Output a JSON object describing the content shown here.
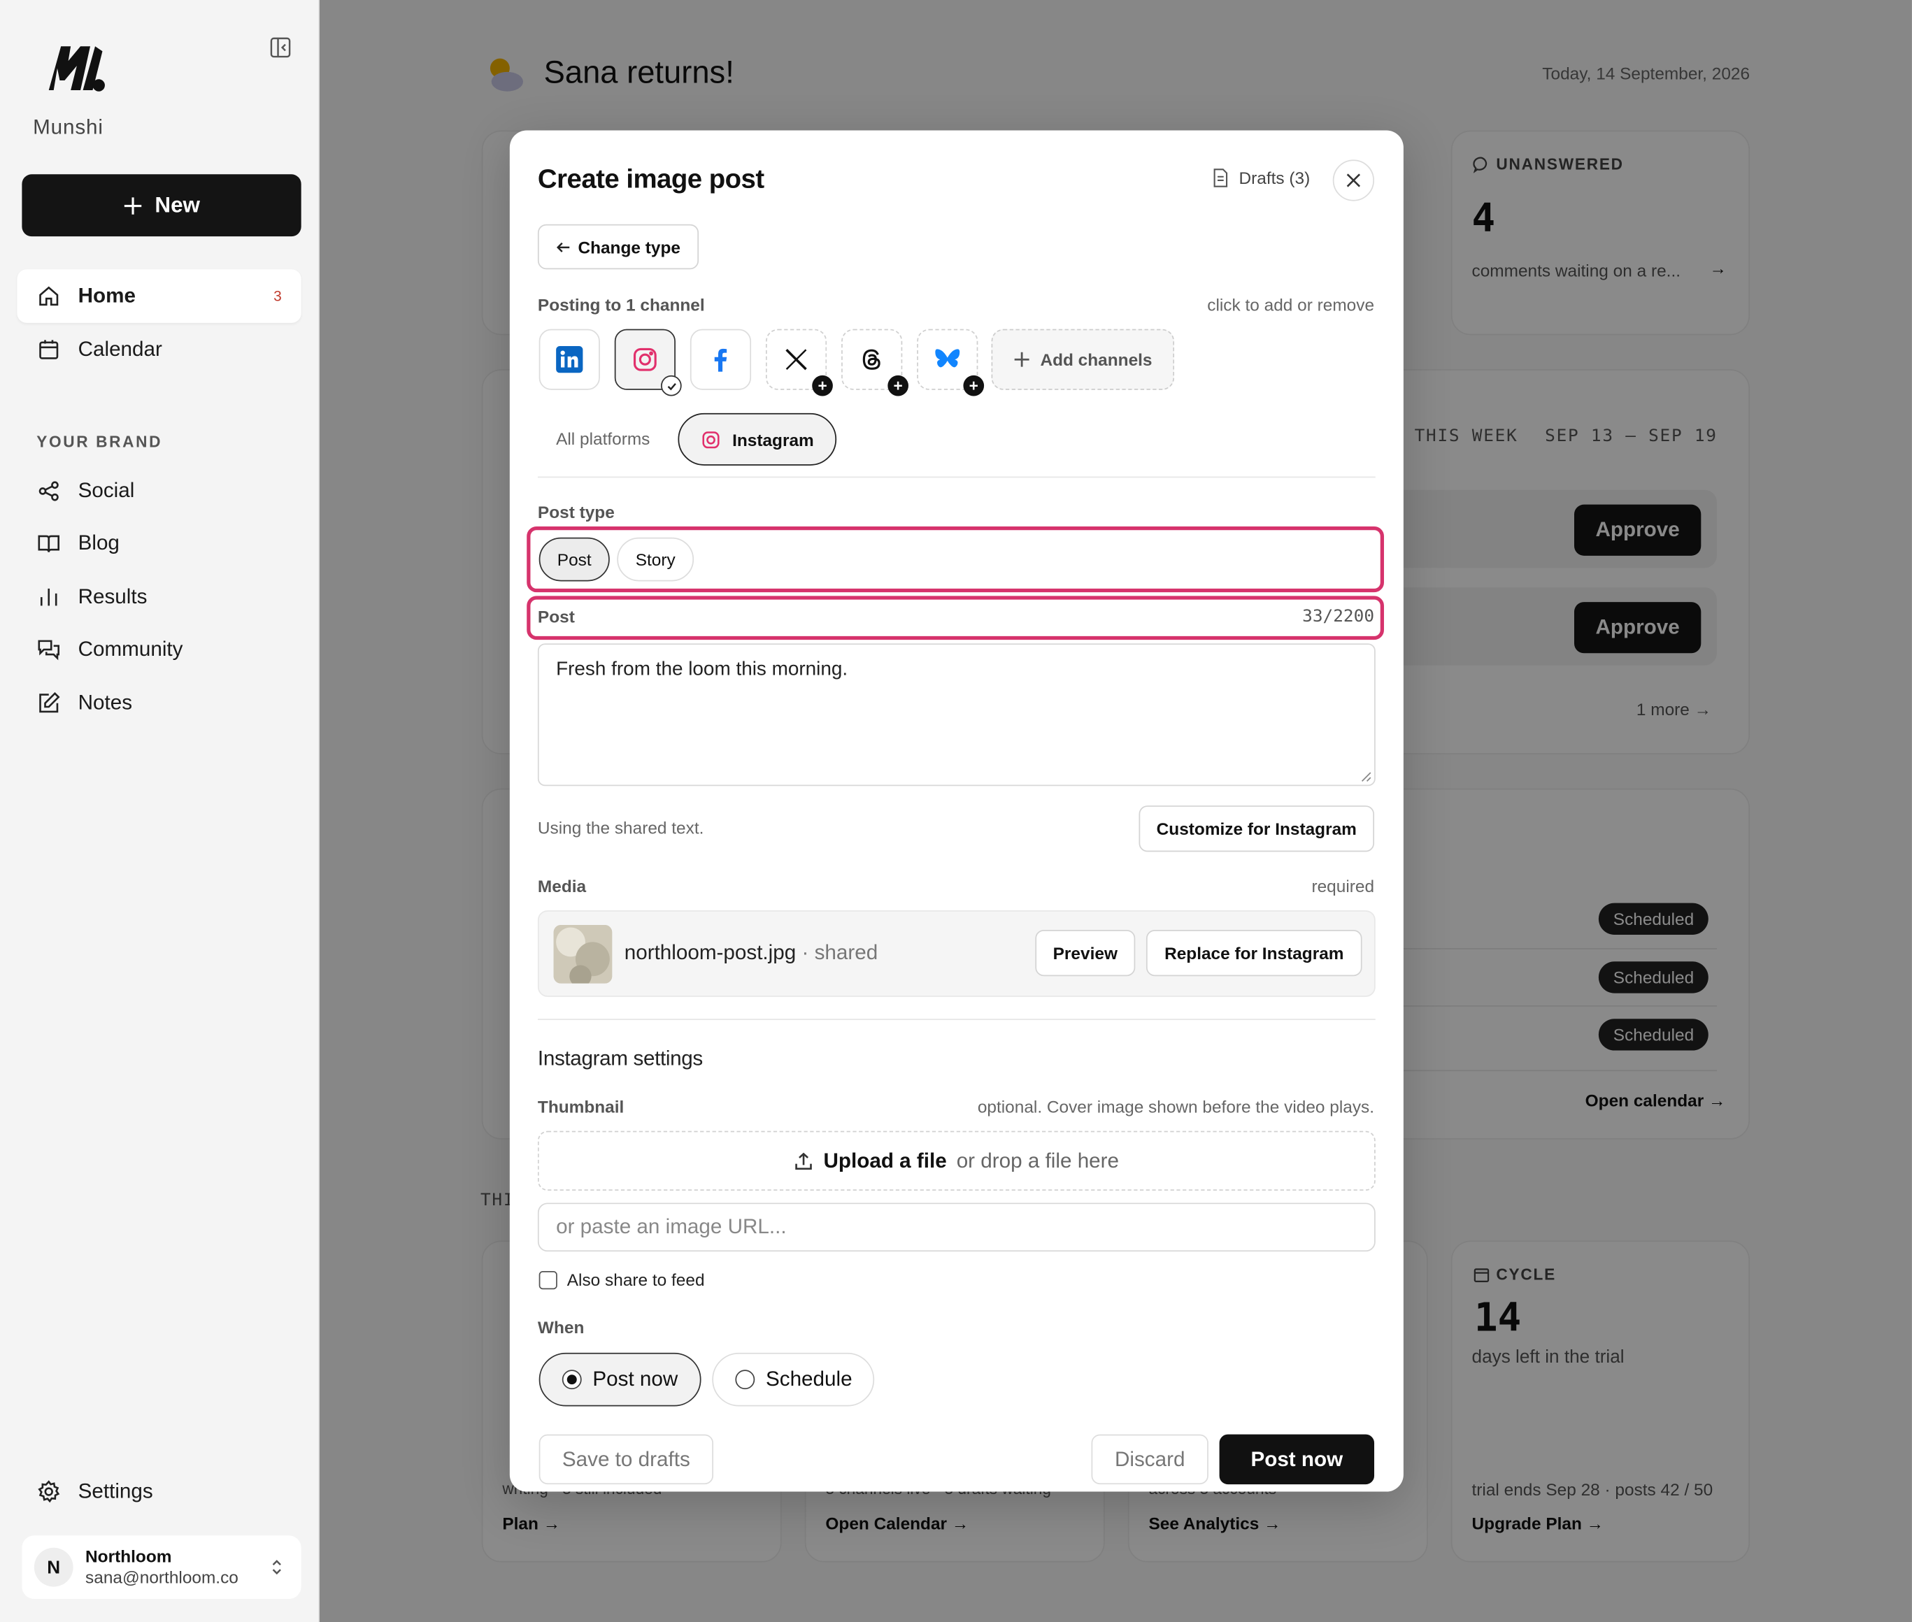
{
  "app": {
    "name": "Munshi"
  },
  "sidebar": {
    "new_label": "New",
    "nav": [
      {
        "label": "Home",
        "badge": "3"
      },
      {
        "label": "Calendar"
      }
    ],
    "section_label": "YOUR BRAND",
    "brand_items": [
      {
        "label": "Social"
      },
      {
        "label": "Blog"
      },
      {
        "label": "Results"
      },
      {
        "label": "Community"
      },
      {
        "label": "Notes"
      }
    ],
    "settings_label": "Settings",
    "account": {
      "initial": "N",
      "name": "Northloom",
      "email": "sana@northloom.co"
    }
  },
  "dashboard": {
    "greeting": "Sana returns!",
    "date": "Today, 14 September, 2026",
    "unanswered": {
      "label": "UNANSWERED",
      "value": "4",
      "text": "comments waiting on a re..."
    },
    "week": {
      "label": "THIS WEEK",
      "range": "SEP 13 – SEP 19",
      "approve_label": "Approve",
      "more": "1 more"
    },
    "scheduled_label": "Scheduled",
    "open_calendar": "Open calendar →",
    "section_prefix": "THI",
    "cards": [
      {
        "text": "writing · 3 still included",
        "link": "Plan →"
      },
      {
        "text": "3 channels live · 3 drafts waiting",
        "link": "Open Calendar →"
      },
      {
        "text": "across 3 accounts",
        "link": "See Analytics →"
      },
      {
        "label": "CYCLE",
        "value": "14",
        "text": "days left in the trial",
        "footer": "trial ends Sep 28 · posts 42 / 50",
        "link": "Upgrade Plan →"
      }
    ]
  },
  "modal": {
    "title": "Create image post",
    "drafts_label": "Drafts (3)",
    "change_type_label": "Change type",
    "posting_to": "Posting to 1 channel",
    "posting_hint": "click to add or remove",
    "channels": [
      {
        "name": "LinkedIn",
        "icon": "linkedin-icon",
        "color": "#0a66c2",
        "state": "available"
      },
      {
        "name": "Instagram",
        "icon": "instagram-icon",
        "color": "#e1306c",
        "state": "selected"
      },
      {
        "name": "Facebook",
        "icon": "facebook-icon",
        "color": "#1877f2",
        "state": "available"
      },
      {
        "name": "X",
        "icon": "x-icon",
        "color": "#000000",
        "state": "not-connected"
      },
      {
        "name": "Threads",
        "icon": "threads-icon",
        "color": "#000000",
        "state": "not-connected"
      },
      {
        "name": "Bluesky",
        "icon": "bluesky-icon",
        "color": "#1185fe",
        "state": "not-connected"
      }
    ],
    "add_channels_label": "Add channels",
    "tabs": {
      "all": "All platforms",
      "instagram": "Instagram"
    },
    "post_type_label": "Post type",
    "post_types": [
      "Post",
      "Story"
    ],
    "selected_post_type": "Post",
    "post_label": "Post",
    "char_count": "33/2200",
    "post_text": "Fresh from the loom this morning.",
    "shared_text_hint": "Using the shared text.",
    "customize_label": "Customize for Instagram",
    "media_label": "Media",
    "media_required": "required",
    "media_file": "northloom-post.jpg",
    "media_shared": " · shared",
    "preview_label": "Preview",
    "replace_label": "Replace for Instagram",
    "settings_title": "Instagram settings",
    "thumbnail_label": "Thumbnail",
    "thumbnail_hint": "optional. Cover image shown before the video plays.",
    "upload_label": "Upload a file",
    "upload_hint": "or drop a file here",
    "url_placeholder": "or paste an image URL...",
    "share_feed_label": "Also share to feed",
    "when_label": "When",
    "when_options": [
      "Post now",
      "Schedule"
    ],
    "save_drafts_label": "Save to drafts",
    "discard_label": "Discard",
    "post_now_label": "Post now"
  },
  "colors": {
    "highlight": "#d6336c",
    "accent_dark": "#111111"
  }
}
